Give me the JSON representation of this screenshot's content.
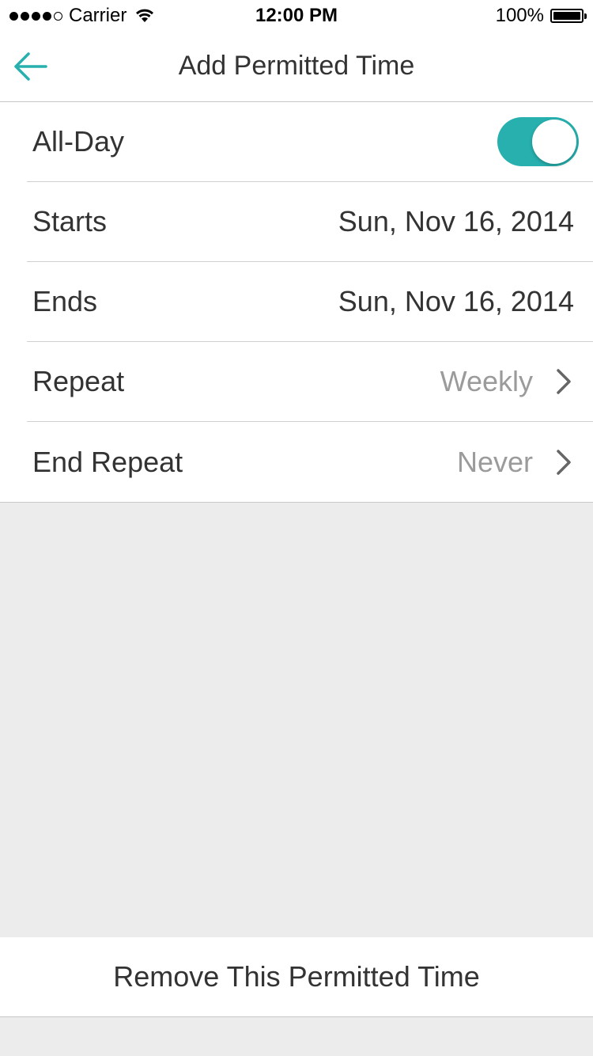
{
  "status_bar": {
    "carrier": "Carrier",
    "time": "12:00 PM",
    "battery_percent": "100%",
    "battery_level": 1.0,
    "signal_filled_dots": 4,
    "signal_total_dots": 5
  },
  "nav": {
    "title": "Add Permitted Time",
    "back_icon": "arrow-left-icon",
    "accent_color": "#27b0ae"
  },
  "settings": {
    "all_day": {
      "label": "All-Day",
      "enabled": true
    },
    "starts": {
      "label": "Starts",
      "value": "Sun, Nov 16, 2014"
    },
    "ends": {
      "label": "Ends",
      "value": "Sun, Nov 16, 2014"
    },
    "repeat": {
      "label": "Repeat",
      "value": "Weekly"
    },
    "end_repeat": {
      "label": "End Repeat",
      "value": "Never"
    }
  },
  "remove_button": {
    "label": "Remove This Permitted Time"
  },
  "colors": {
    "toggle_on": "#27b0ae",
    "background": "#ececec",
    "muted_text": "#9b9b9b"
  }
}
